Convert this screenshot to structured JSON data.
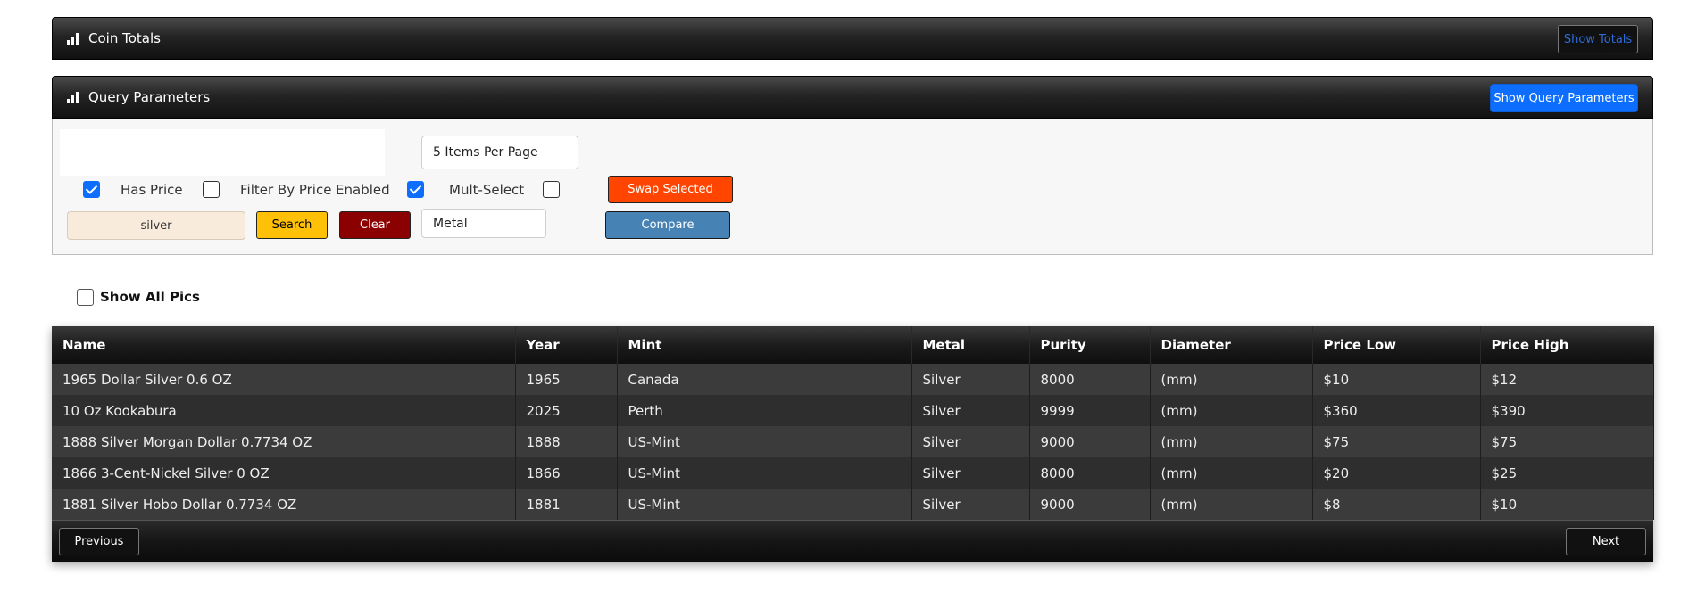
{
  "coin_totals": {
    "title": "Coin Totals",
    "show_button": "Show Totals"
  },
  "query_parameters": {
    "title": "Query Parameters",
    "show_button": "Show Query Parameters",
    "items_per_page": "5 Items Per Page",
    "has_price": {
      "label": "Has Price",
      "checked": true
    },
    "filter_by_price": {
      "label": "Filter By Price",
      "checked": false
    },
    "enabled": {
      "label": "Enabled",
      "checked": true
    },
    "multi_select": {
      "label": "Mult-Select",
      "checked": false
    },
    "search_value": "silver",
    "search_button": "Search",
    "clear_button": "Clear",
    "metal_value": "Metal",
    "swap_button": "Swap Selected",
    "compare_button": "Compare"
  },
  "show_all_pics": {
    "label": "Show All Pics",
    "checked": false
  },
  "grid": {
    "columns": [
      "Name",
      "Year",
      "Mint",
      "Metal",
      "Purity",
      "Diameter",
      "Price Low",
      "Price High"
    ],
    "rows": [
      [
        "1965 Dollar Silver 0.6 OZ",
        "1965",
        "Canada",
        "Silver",
        "8000",
        "(mm)",
        "$10",
        "$12"
      ],
      [
        "10 Oz Kookabura",
        "2025",
        "Perth",
        "Silver",
        "9999",
        "(mm)",
        "$360",
        "$390"
      ],
      [
        "1888 Silver Morgan Dollar 0.7734 OZ",
        "1888",
        "US-Mint",
        "Silver",
        "9000",
        "(mm)",
        "$75",
        "$75"
      ],
      [
        "1866 3-Cent-Nickel Silver 0 OZ",
        "1866",
        "US-Mint",
        "Silver",
        "8000",
        "(mm)",
        "$20",
        "$25"
      ],
      [
        "1881 Silver Hobo Dollar 0.7734 OZ",
        "1881",
        "US-Mint",
        "Silver",
        "9000",
        "(mm)",
        "$8",
        "$10"
      ]
    ],
    "previous_button": "Previous",
    "next_button": "Next"
  }
}
